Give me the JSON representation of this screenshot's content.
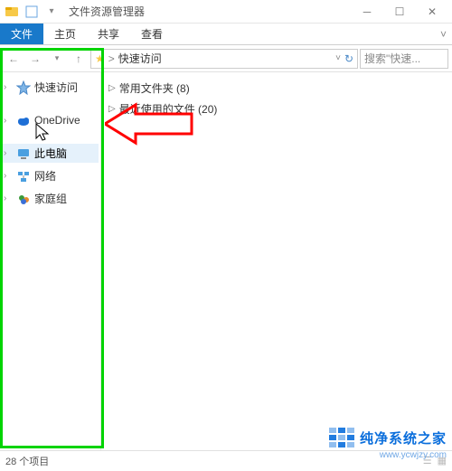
{
  "window": {
    "title": "文件资源管理器"
  },
  "ribbon": {
    "file": "文件",
    "home": "主页",
    "share": "共享",
    "view": "查看"
  },
  "nav": {
    "back_glyph": "←",
    "fwd_glyph": "→",
    "up_glyph": "↑",
    "drop_glyph": "▾",
    "addr_chev": ">",
    "addr_label": "快速访问",
    "search_placeholder": "搜索\"快速..."
  },
  "tree": [
    {
      "label": "快速访问",
      "icon": "star",
      "expandable": true
    },
    {
      "label": "OneDrive",
      "icon": "cloud",
      "expandable": true
    },
    {
      "label": "此电脑",
      "icon": "pc",
      "expandable": true,
      "selected": true
    },
    {
      "label": "网络",
      "icon": "network",
      "expandable": true
    },
    {
      "label": "家庭组",
      "icon": "homegroup",
      "expandable": true
    }
  ],
  "groups": [
    {
      "label": "常用文件夹",
      "count": 8
    },
    {
      "label": "最近使用的文件",
      "count": 20
    }
  ],
  "status": {
    "items_label": "28 个项目"
  },
  "watermark": {
    "brand": "纯净系统之家",
    "url": "www.ycwjzy.com"
  },
  "colors": {
    "accent": "#1979ca",
    "arrow": "#ff0000",
    "highlight_box": "#00d400"
  }
}
